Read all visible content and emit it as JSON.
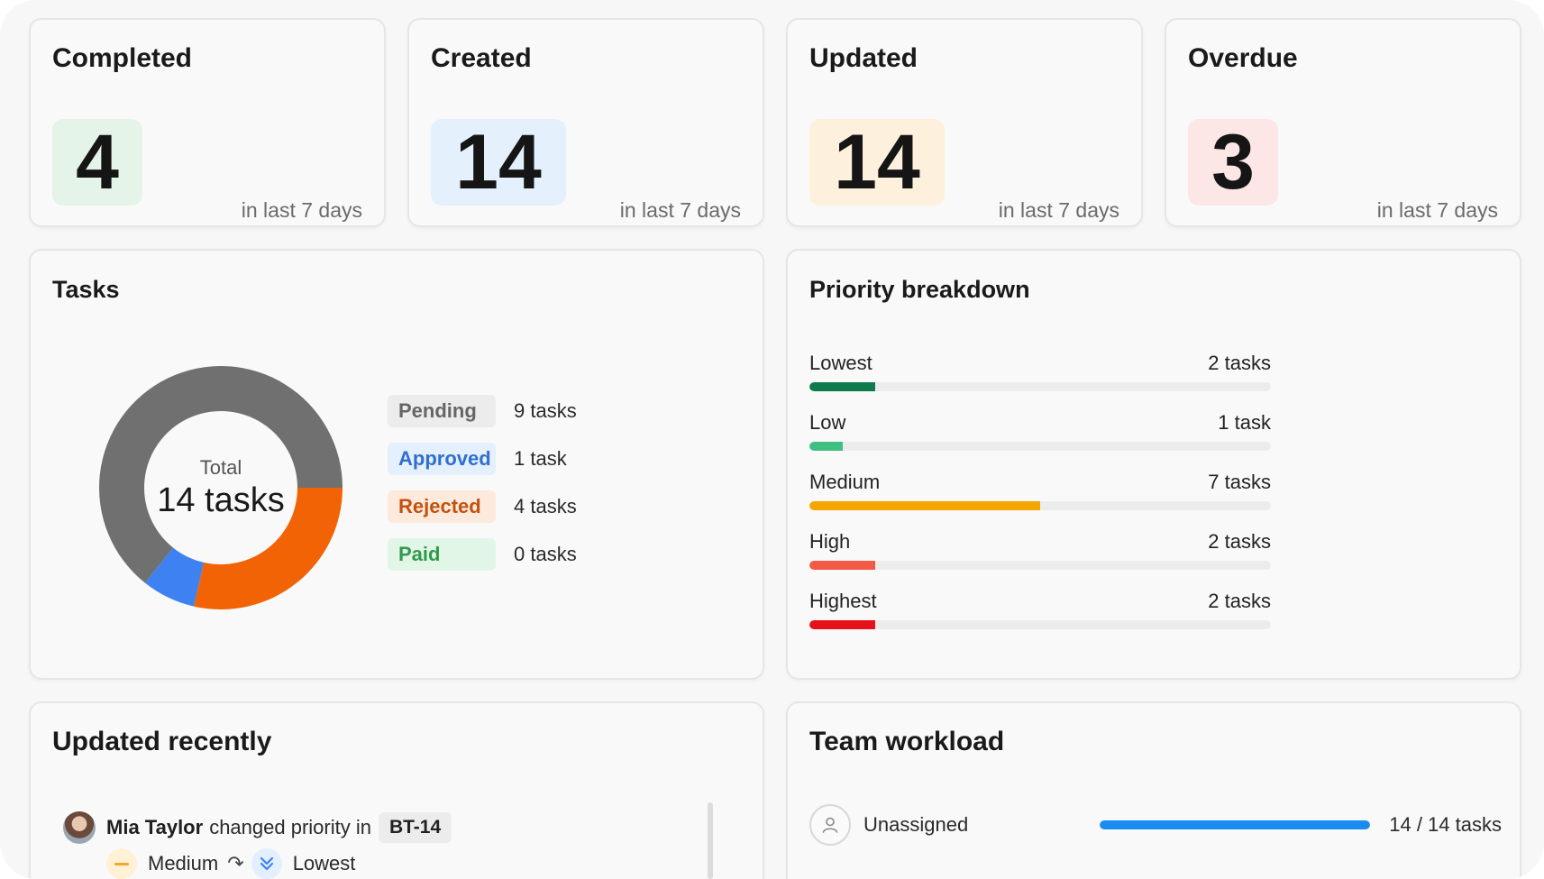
{
  "stats": [
    {
      "title": "Completed",
      "value": "4",
      "sub": "in last 7 days",
      "bg": "#e4f4e8"
    },
    {
      "title": "Created",
      "value": "14",
      "sub": "in last 7 days",
      "bg": "#e4f1fd"
    },
    {
      "title": "Updated",
      "value": "14",
      "sub": "in last 7 days",
      "bg": "#fdf0dc"
    },
    {
      "title": "Overdue",
      "value": "3",
      "sub": "in last 7 days",
      "bg": "#fde6e6"
    }
  ],
  "tasks": {
    "title": "Tasks",
    "total_label": "Total",
    "total_value": "14 tasks",
    "legend": [
      {
        "label": "Pending",
        "count": "9 tasks",
        "text_color": "#666666",
        "bg": "#ececec"
      },
      {
        "label": "Approved",
        "count": "1 task",
        "text_color": "#2f6fcf",
        "bg": "#e4f0fd"
      },
      {
        "label": "Rejected",
        "count": "4 tasks",
        "text_color": "#c2530f",
        "bg": "#fdeadd"
      },
      {
        "label": "Paid",
        "count": "0 tasks",
        "text_color": "#2f9a4e",
        "bg": "#e2f6e7"
      }
    ],
    "donut": [
      {
        "label": "Pending",
        "value": 9,
        "color": "#707070"
      },
      {
        "label": "Rejected",
        "value": 4,
        "color": "#f26306"
      },
      {
        "label": "Approved",
        "value": 1,
        "color": "#3d82f0"
      },
      {
        "label": "Paid",
        "value": 0,
        "color": "#35b05a"
      }
    ]
  },
  "priority": {
    "title": "Priority breakdown",
    "total": 14,
    "rows": [
      {
        "label": "Lowest",
        "count": "2 tasks",
        "value": 2,
        "color": "#0f7a4c"
      },
      {
        "label": "Low",
        "count": "1 task",
        "value": 1,
        "color": "#3fbf80"
      },
      {
        "label": "Medium",
        "count": "7 tasks",
        "value": 7,
        "color": "#f7a500"
      },
      {
        "label": "High",
        "count": "2 tasks",
        "value": 2,
        "color": "#f25a45"
      },
      {
        "label": "Highest",
        "count": "2 tasks",
        "value": 2,
        "color": "#e8101b"
      }
    ]
  },
  "recent": {
    "title": "Updated recently",
    "name": "Mia Taylor",
    "action": "changed priority in",
    "issue_key": "BT-14",
    "from_value": "Medium",
    "to_value": "Lowest"
  },
  "workload": {
    "title": "Team workload",
    "assignee": "Unassigned",
    "count": "14 / 14 tasks",
    "fraction": 1.0
  }
}
